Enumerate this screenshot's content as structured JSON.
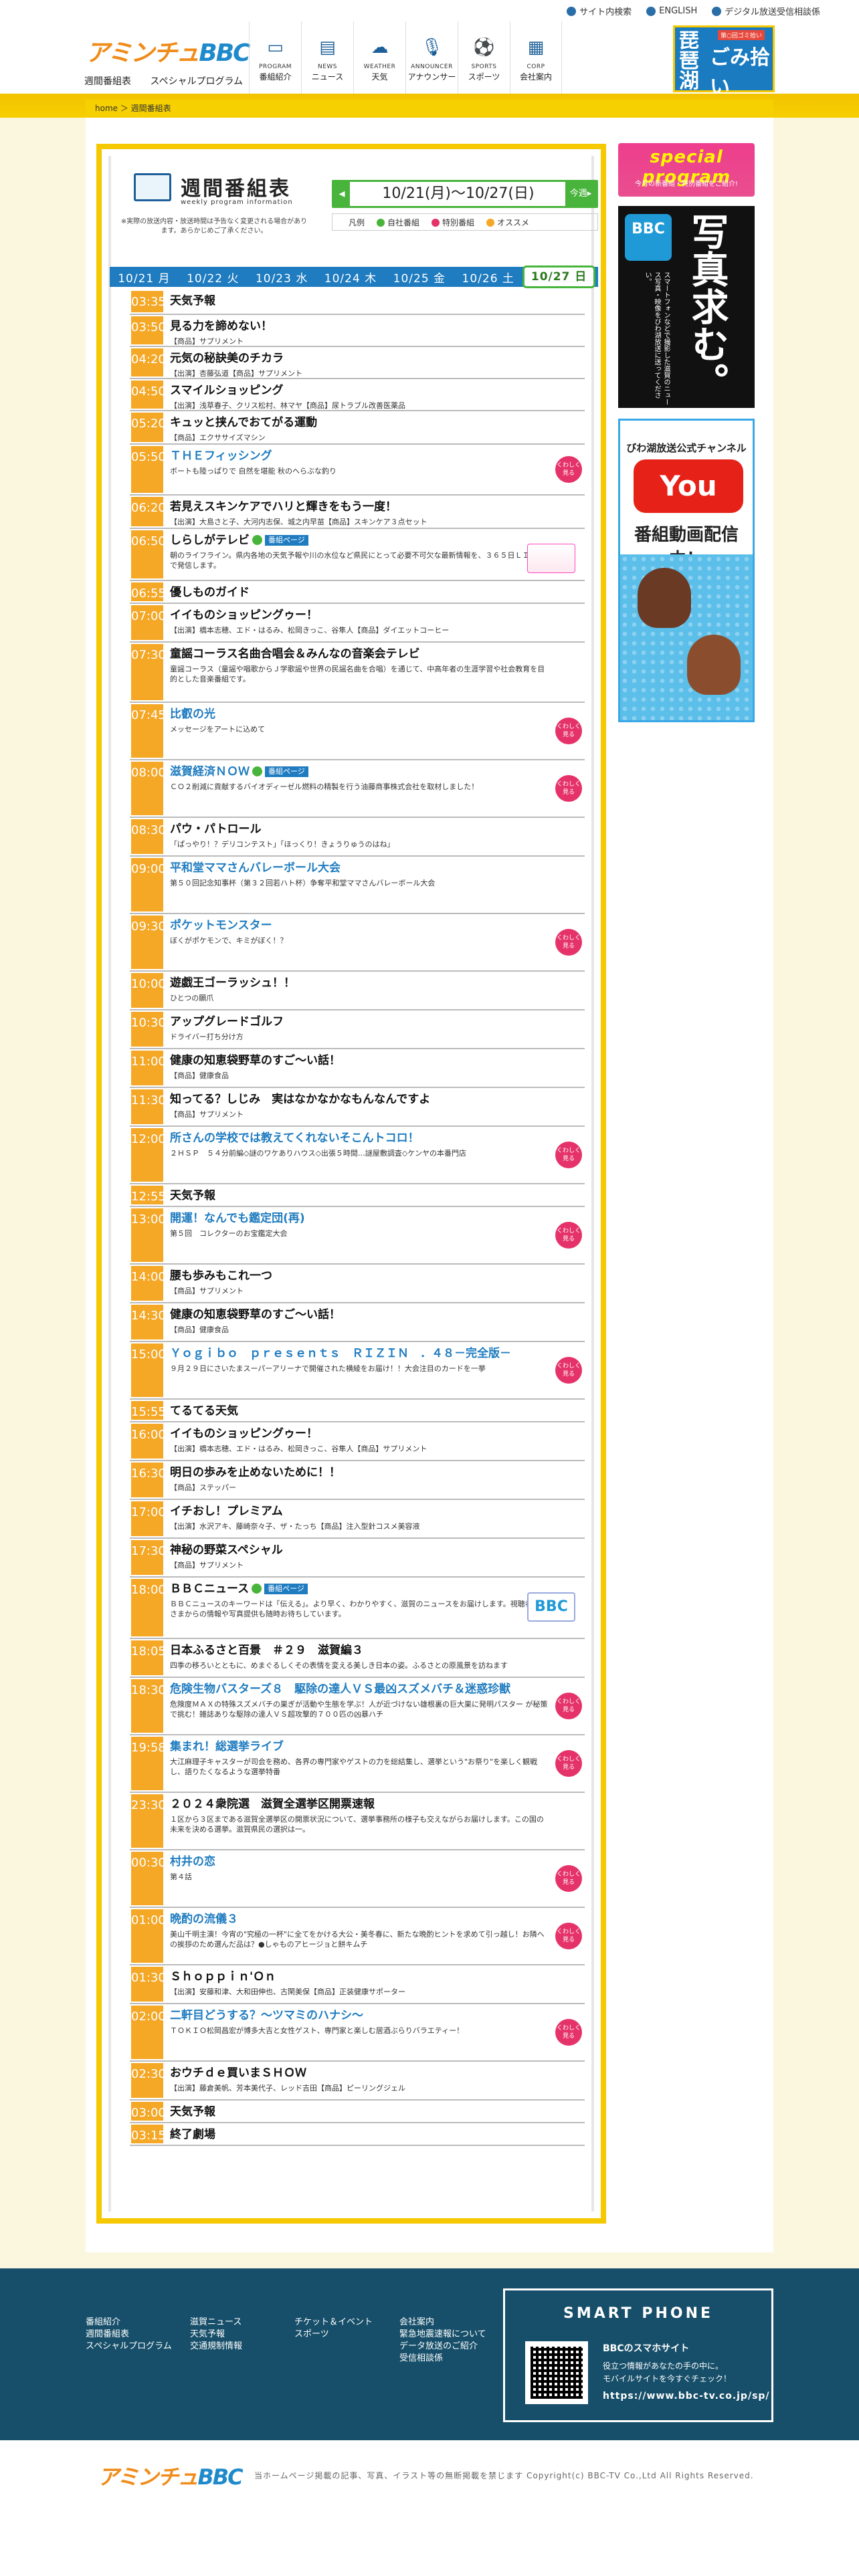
{
  "header": {
    "logo": "アミンチュBBC",
    "sublinks": [
      "週間番組表",
      "スペシャルプログラム"
    ],
    "toplinks": [
      "サイト内検索",
      "ENGLISH",
      "デジタル放送受信相談係"
    ],
    "nav": [
      {
        "en": "PROGRAM",
        "jp": "番組紹介",
        "icon": "tv-icon"
      },
      {
        "en": "NEWS",
        "jp": "ニュース",
        "icon": "news-icon"
      },
      {
        "en": "WEATHER",
        "jp": "天気",
        "icon": "cloud-icon"
      },
      {
        "en": "ANNOUNCER",
        "jp": "アナウンサー",
        "icon": "microphone-icon"
      },
      {
        "en": "SPORTS",
        "jp": "スポーツ",
        "icon": "sports-icon"
      },
      {
        "en": "CORP",
        "jp": "会社案内",
        "icon": "building-icon"
      }
    ],
    "banner": {
      "k": "琵琶湖",
      "g": "ごみ拾い",
      "t": "第○回ゴミ拾い",
      "s": "一周",
      "c": "CHANGE"
    }
  },
  "breadcrumb": {
    "home": "home",
    "current": "週間番組表"
  },
  "schedule": {
    "title": "週間番組表",
    "title_en": "weekly program information",
    "note": "※実際の放送内容・放送時間は予告なく変更される場合があります。あらかじめご了承ください。",
    "week": "10/21(月)～10/27(日)",
    "next": "今週▸",
    "prev": "◂",
    "legend": [
      "凡例",
      "自社番組",
      "特別番組",
      "オススメ"
    ],
    "days": [
      "10/21 月",
      "10/22 火",
      "10/23 水",
      "10/24 木",
      "10/25 金",
      "10/26 土",
      "10/27 日"
    ],
    "more": "くわしく\n見る",
    "programs": [
      {
        "t": "03:35",
        "title": "天気予報",
        "desc": "",
        "h": 38
      },
      {
        "t": "03:50",
        "title": "見る力を諦めない！",
        "desc": "【商品】サプリメント",
        "h": 48
      },
      {
        "t": "04:20",
        "title": "元気の秘訣美のチカラ",
        "desc": "【出演】杏藤弘道【商品】サプリメント",
        "h": 48
      },
      {
        "t": "04:50",
        "title": "スマイルショッピング",
        "desc": "【出演】浅草春子、クリス松村、林マヤ【商品】尿トラブル改善医薬品",
        "h": 48
      },
      {
        "t": "05:20",
        "title": "キュッと挟んでおてがる運動",
        "desc": "【商品】エクササイズマシン",
        "h": 50
      },
      {
        "t": "05:50",
        "title": "ＴＨＥフィッシング",
        "desc": "ボートも陸っぱりで 自然を堪能 秋のへらぶな釣り",
        "h": 76,
        "blue": true,
        "more": true
      },
      {
        "t": "06:20",
        "title": "若見えスキンケアでハリと輝きをもう一度！",
        "desc": "【出演】大島さと子、大河内志保、城之内早苗【商品】スキンケア３点セット",
        "h": 50
      },
      {
        "t": "06:50",
        "title": "しらしがテレビ",
        "desc": "朝のライフライン。県内各地の天気予報や川の水位など県民にとって必要不可欠な最新情報を、３６５日ＬＩＶＥで発信します。",
        "h": 78,
        "badge": "番組ページ",
        "green": true,
        "thumb": true
      },
      {
        "t": "06:55",
        "title": "優しものガイド",
        "desc": "",
        "h": 34
      },
      {
        "t": "07:00",
        "title": "イイものショッピングゥー！",
        "desc": "【出演】橋本志穂、エド・はるみ、松岡きっこ、谷隼人【商品】ダイエットコーヒー",
        "h": 58
      },
      {
        "t": "07:30",
        "title": "童謡コーラス名曲合唱会＆みんなの音楽会テレビ",
        "desc": "童謡コーラス（童謡や唱歌からＪ学歌謡や世界の民謡名曲を合唱）を通じて、中高年者の生涯学習や社会教育を目的とした音楽番組です。",
        "h": 90
      },
      {
        "t": "07:45",
        "title": "比叡の光",
        "desc": "メッセージをアートに込めて",
        "h": 86,
        "blue": true,
        "more": true
      },
      {
        "t": "08:00",
        "title": "滋賀経済ＮＯＷ",
        "desc": "ＣＯ２削減に貢献するバイオディーゼル燃料の精製を行う油藤商事株式会社を取材しました！",
        "h": 86,
        "blue": true,
        "badge": "番組ページ",
        "green": true,
        "more": true
      },
      {
        "t": "08:30",
        "title": "パウ・パトロール",
        "desc": "「ぱっやり！？デリコンテスト」「ほっくり！きょうりゅうのはね」",
        "h": 58
      },
      {
        "t": "09:00",
        "title": "平和堂ママさんバレーボール大会",
        "desc": "第５０回記念知事杯（第３２回若ハト杯）争奪平和堂ママさんバレーボール大会",
        "h": 86,
        "blue": true
      },
      {
        "t": "09:30",
        "title": "ポケットモンスター",
        "desc": "ぼくがポケモンで、キミがぼく！？",
        "h": 86,
        "blue": true,
        "more": true
      },
      {
        "t": "10:00",
        "title": "遊戯王ゴーラッシュ！！",
        "desc": "ひとつの願爪",
        "h": 58
      },
      {
        "t": "10:30",
        "title": "アップグレードゴルフ",
        "desc": "ドライバー打ち分け方",
        "h": 58
      },
      {
        "t": "11:00",
        "title": "健康の知恵袋野草のすご〜い話！",
        "desc": "【商品】健康食品",
        "h": 58
      },
      {
        "t": "11:30",
        "title": "知ってる？しじみ　実はなかなかなもんなんですよ",
        "desc": "【商品】サプリメント",
        "h": 58
      },
      {
        "t": "12:00",
        "title": "所さんの学校では教えてくれないそこんトコロ！",
        "desc": "２ＨＳＰ　５４分前編◇謎のワケありハウス◇出張５時間…謎屋敷調査◇ケンヤの本番門店",
        "h": 86,
        "blue": true,
        "more": true
      },
      {
        "t": "12:55",
        "title": "天気予報",
        "desc": "",
        "h": 34
      },
      {
        "t": "13:00",
        "title": "開運！なんでも鑑定団(再)",
        "desc": "第５回　コレクターのお宝鑑定大会",
        "h": 86,
        "blue": true,
        "more": true
      },
      {
        "t": "14:00",
        "title": "腰も歩みもこれ一つ",
        "desc": "【商品】サプリメント",
        "h": 58
      },
      {
        "t": "14:30",
        "title": "健康の知恵袋野草のすご〜い話！",
        "desc": "【商品】健康食品",
        "h": 58
      },
      {
        "t": "15:00",
        "title": "Ｙｏｇｉｂｏ　ｐｒｅｓｅｎｔｓ　ＲＩＺＩＮ　．４８－完全版－",
        "desc": "９月２９日にさいたまスーパーアリーナで開催された横綾をお届け！！大会注目のカードを一挙",
        "h": 86,
        "blue": true,
        "more": true
      },
      {
        "t": "15:55",
        "title": "てるてる天気",
        "desc": "",
        "h": 34
      },
      {
        "t": "16:00",
        "title": "イイものショッピングゥー！",
        "desc": "【出演】橋本志穂、エド・はるみ、松岡きっこ、谷隼人【商品】サプリメント",
        "h": 58
      },
      {
        "t": "16:30",
        "title": "明日の歩みを止めないために！！",
        "desc": "【商品】ステッパー",
        "h": 58
      },
      {
        "t": "17:00",
        "title": "イチおし！プレミアム",
        "desc": "【出演】水沢アキ、藤崎奈々子、ザ・たっち【商品】注入型針コスメ美容液",
        "h": 58
      },
      {
        "t": "17:30",
        "title": "神秘の野菜スペシャル",
        "desc": "【商品】サプリメント",
        "h": 58
      },
      {
        "t": "18:00",
        "title": "ＢＢＣニュース",
        "desc": "ＢＢＣニュースのキーワードは「伝える」。より早く、わかりやすく、滋賀のニュースをお届けします。視聴者の皆さまからの情報や写真提供も随時お待ちしています。",
        "h": 92,
        "badge": "番組ページ",
        "green": true,
        "newsthumb": true
      },
      {
        "t": "18:05",
        "title": "日本ふるさと百景　＃２９　滋賀編３",
        "desc": "四季の移ろいとともに、めまぐるしくその表情を変える美しき日本の姿。ふるさとの原風景を訪ねます",
        "h": 58
      },
      {
        "t": "18:30",
        "title": "危険生物バスターズ８　駆除の達人ＶＳ最凶スズメバチ＆迷惑珍獣",
        "desc": "危険度ＭＡＸの特殊スズメバチの巣ぎが活動や生態を学ぶ！人が近づけない雄根裏の巨大巣に発明パスター が秘策で挑む！雑誌ありな駆除の達人ＶＳ超攻撃的７００匹の凶暴ハチ",
        "h": 86,
        "blue": true,
        "more": true
      },
      {
        "t": "19:58",
        "title": "集まれ！総選挙ライブ",
        "desc": "大江麻理子キャスターが司会を務め、各界の専門家やゲストの力を総結集し、選挙という\"お祭り\"を楽しく観戦し、語りたくなるような選挙特番",
        "h": 86,
        "blue": true,
        "more": true
      },
      {
        "t": "23:30",
        "title": "２０２４衆院選　滋賀全選挙区開票速報",
        "desc": "１区から３区まである滋賀全選挙区の開票状況について、選挙事務所の様子も交えながらお届けします。この国の未来を決める選挙。滋賀県民の選択は一。",
        "h": 86
      },
      {
        "t": "00:30",
        "title": "村井の恋",
        "desc": "第４話",
        "h": 86,
        "blue": true,
        "more": true
      },
      {
        "t": "01:00",
        "title": "晩酌の流儀３",
        "desc": "美山千明主演！今宵の\"究極の一杯\"に全てをかける大公・美冬春に、新たな晩酌ヒントを求めて引っ越し！お隣への挨拶のため選んだ品は？●しゃものアヒージョと餅キムチ",
        "h": 86,
        "blue": true,
        "more": true
      },
      {
        "t": "01:30",
        "title": "Ｓｈｏｐｐｉｎ'Ｏｎ",
        "desc": "【出演】安藤和津、大和田伸也、古閑美保【商品】正装健康サポーター",
        "h": 58
      },
      {
        "t": "02:00",
        "title": "二軒目どうする？～ツマミのハナシ～",
        "desc": "ＴＯＫＩＯ松岡昌宏が博多大吉と女性ゲスト、専門家と楽しむ居酒ぶらりバラエティー！",
        "h": 86,
        "blue": true,
        "more": true
      },
      {
        "t": "02:30",
        "title": "おウチｄｅ買いまＳＨＯＷ",
        "desc": "【出演】藤倉美帆、芳本美代子、レッド吉田【商品】ピーリングジェル",
        "h": 58
      },
      {
        "t": "03:00",
        "title": "天気予報",
        "desc": "",
        "h": 34
      },
      {
        "t": "03:15",
        "title": "終了劇場",
        "desc": "",
        "h": 34
      }
    ]
  },
  "sidebar": {
    "special": {
      "title": "special program",
      "sub": "今月の新番組・特別番組をご紹介!"
    },
    "photo": {
      "bbc": "BBC",
      "vtext": "スマートフォンなどで撮影した滋賀のニュース写真・映像をびわ湖放送に送ってください。",
      "big": "写真求む。"
    },
    "youtube": {
      "title": "びわ湖放送公式チャンネル",
      "logo": "You Tube",
      "sub": "番組動画配信中！"
    }
  },
  "footer": {
    "col1": [
      "番組紹介",
      "週間番組表",
      "スペシャルプログラム"
    ],
    "col2": [
      "滋賀ニュース",
      "天気予報",
      "交通規制情報"
    ],
    "col3": [
      "チケット＆イベント",
      "スポーツ"
    ],
    "col4": [
      "会社案内",
      "緊急地震速報について",
      "データ放送のご紹介",
      "受信相談係"
    ],
    "smart": {
      "h": "SMART PHONE",
      "s1": "BBCのスマホサイト",
      "s2": "役立つ情報があなたの手の中に。\nモバイルサイトを今すぐチェック！",
      "s3": "https://www.bbc-tv.co.jp/sp/"
    },
    "copyright": "当ホームページ掲載の記事、写真、イラスト等の無断掲載を禁じます Copyright(c) BBC-TV Co.,Ltd All Rights Reserved."
  }
}
